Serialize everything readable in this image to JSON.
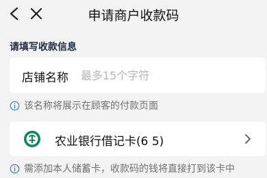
{
  "header": {
    "title": "申请商户收款码",
    "back_icon": "chevron-left-icon",
    "close_icon": "close-icon"
  },
  "section": {
    "heading": "请填写收款信息"
  },
  "shop_name": {
    "label": "店铺名称",
    "placeholder": "最多15个字符",
    "value": "",
    "hint": "该名称将展示在顾客的付款页面"
  },
  "bank": {
    "name": "农业银行借记卡(6            5)",
    "logo_color": "#0a8a5c",
    "logo_icon": "abc-bank-logo-icon",
    "hint": "需添加本人储蓄卡，收款码的钱将直接打到该卡中"
  },
  "colors": {
    "background": "#f3f3f3",
    "card": "#ffffff",
    "info_icon": "#2f7bd6",
    "hint_text": "#707070"
  }
}
